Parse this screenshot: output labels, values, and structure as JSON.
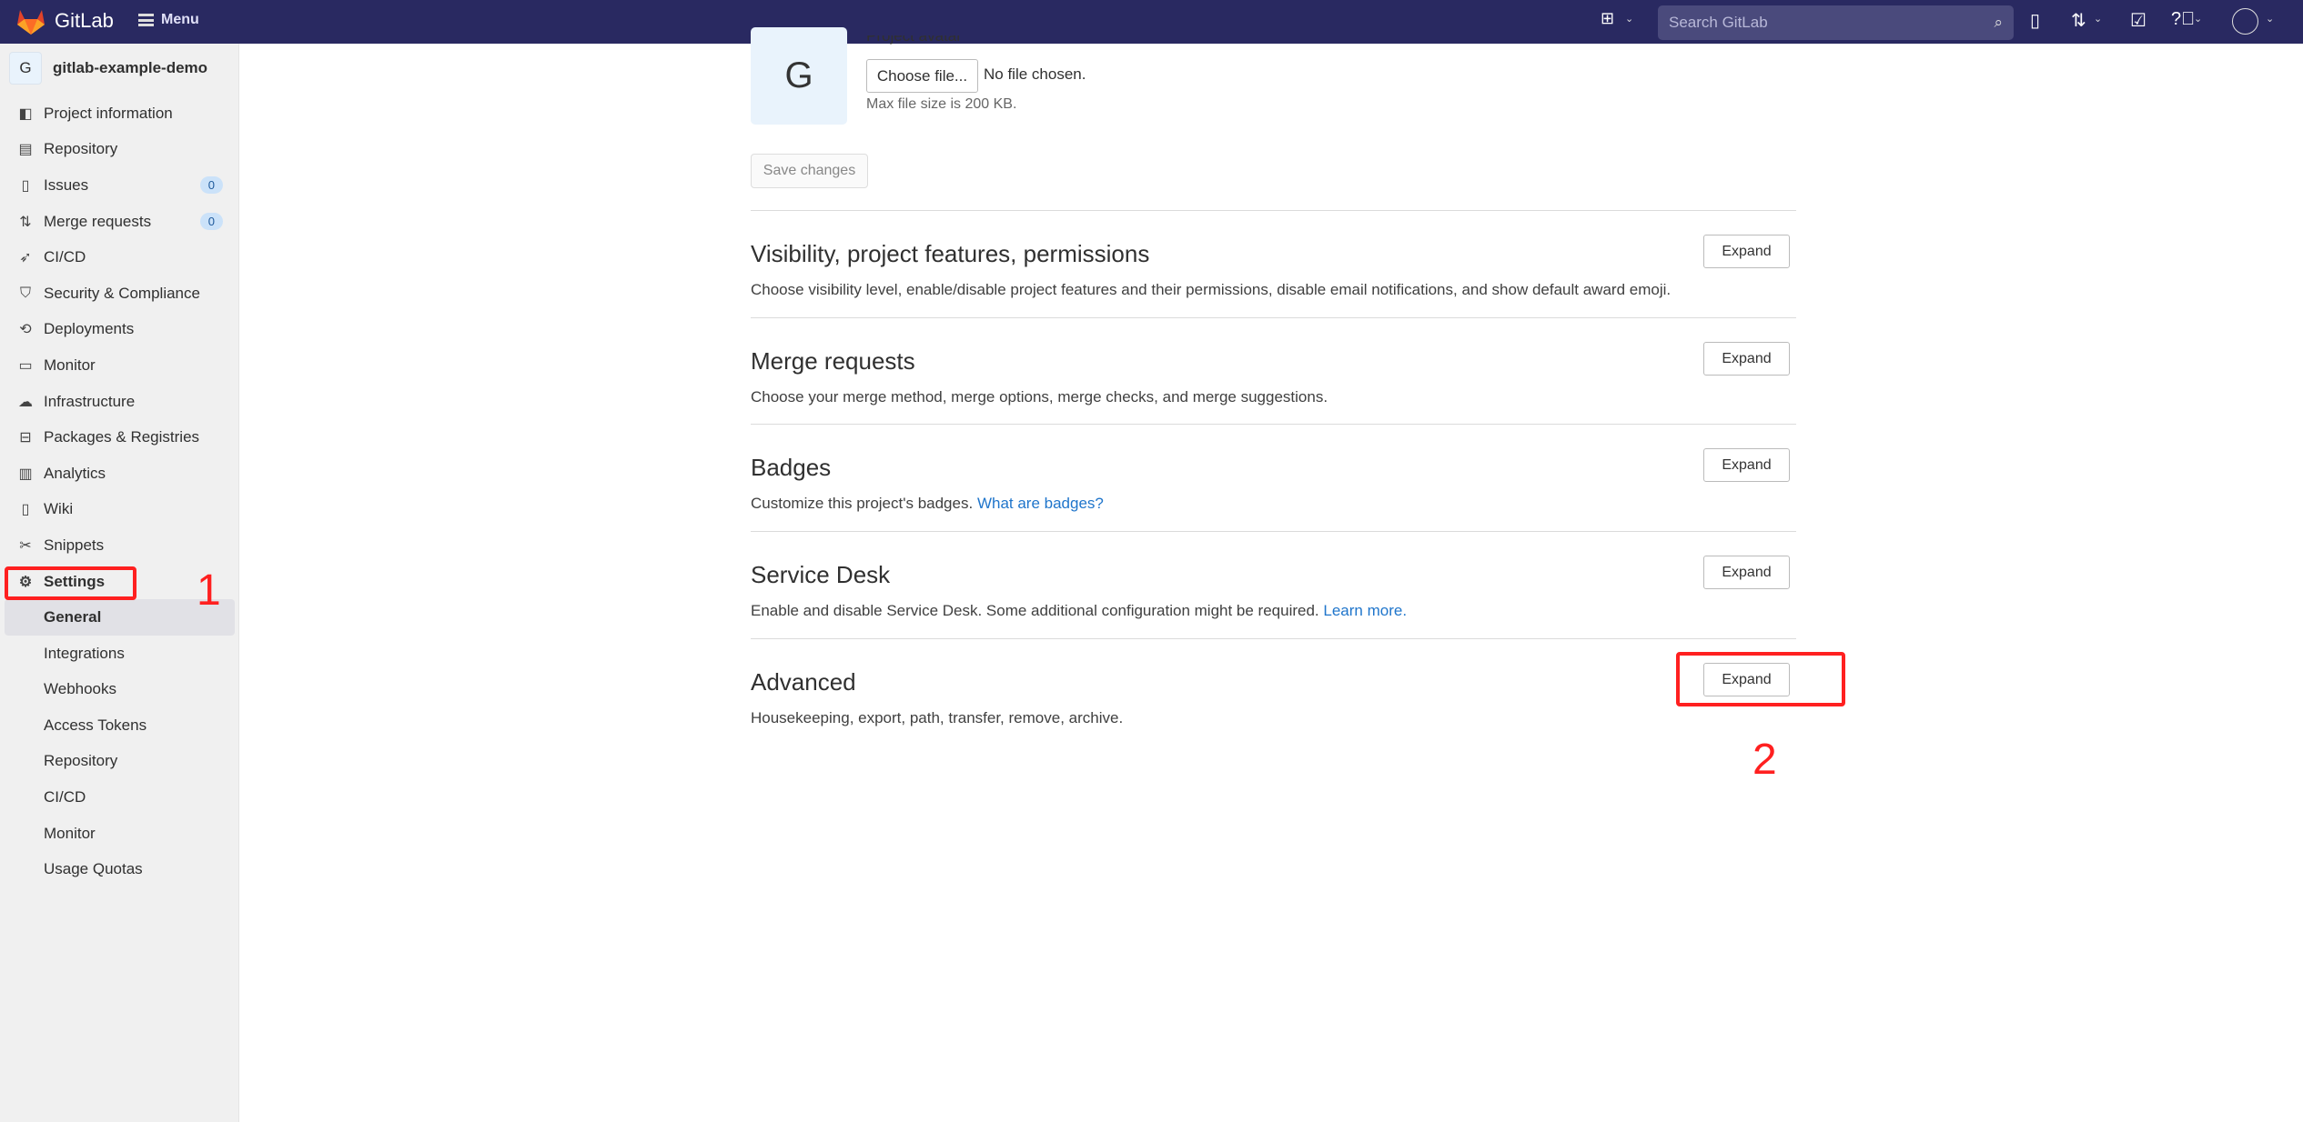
{
  "topbar": {
    "brand": "GitLab",
    "menu": "Menu",
    "search_placeholder": "Search GitLab"
  },
  "sidebar": {
    "project_initial": "G",
    "project_name": "gitlab-example-demo",
    "items": [
      {
        "label": "Project information",
        "icon": "project-icon"
      },
      {
        "label": "Repository",
        "icon": "doc-icon"
      },
      {
        "label": "Issues",
        "icon": "issues-icon",
        "badge": "0"
      },
      {
        "label": "Merge requests",
        "icon": "merge-request-icon",
        "badge": "0"
      },
      {
        "label": "CI/CD",
        "icon": "rocket-icon"
      },
      {
        "label": "Security & Compliance",
        "icon": "shield-icon"
      },
      {
        "label": "Deployments",
        "icon": "deployments-icon"
      },
      {
        "label": "Monitor",
        "icon": "monitor-icon"
      },
      {
        "label": "Infrastructure",
        "icon": "cloud-gear-icon"
      },
      {
        "label": "Packages & Registries",
        "icon": "package-icon"
      },
      {
        "label": "Analytics",
        "icon": "chart-icon"
      },
      {
        "label": "Wiki",
        "icon": "book-icon"
      },
      {
        "label": "Snippets",
        "icon": "scissors-icon"
      },
      {
        "label": "Settings",
        "icon": "gear-icon"
      }
    ],
    "settings_sub": [
      "General",
      "Integrations",
      "Webhooks",
      "Access Tokens",
      "Repository",
      "CI/CD",
      "Monitor",
      "Usage Quotas"
    ],
    "active_sub": "General"
  },
  "main": {
    "avatar_label": "Project avatar",
    "avatar_initial": "G",
    "choose_file": "Choose file...",
    "no_file": "No file chosen.",
    "max_size": "Max file size is 200 KB.",
    "save": "Save changes",
    "expand": "Expand",
    "sections": [
      {
        "title": "Visibility, project features, permissions",
        "desc": "Choose visibility level, enable/disable project features and their permissions, disable email notifications, and show default award emoji."
      },
      {
        "title": "Merge requests",
        "desc": "Choose your merge method, merge options, merge checks, and merge suggestions."
      },
      {
        "title": "Badges",
        "desc": "Customize this project's badges.",
        "link": "What are badges?"
      },
      {
        "title": "Service Desk",
        "desc": "Enable and disable Service Desk. Some additional configuration might be required.",
        "link": "Learn more."
      },
      {
        "title": "Advanced",
        "desc": "Housekeeping, export, path, transfer, remove, archive."
      }
    ]
  },
  "annotations": {
    "step1": "1",
    "step2": "2",
    "color": "#ff2020"
  }
}
